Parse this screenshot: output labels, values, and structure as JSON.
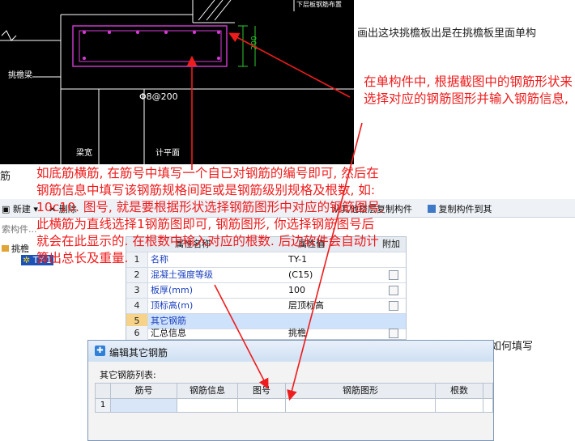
{
  "cad": {
    "label_left_mid": "挑檐梁",
    "label_top_right": "下层板钢筋布置",
    "dim_vertical": "200",
    "rebar_spec": "Φ8@200",
    "label_bottom_left": "梁宽",
    "label_bottom_mid": "计平面"
  },
  "hint_right_top": "画出这块挑檐板出是在挑檐板里面单构",
  "hint_left": "筋",
  "hint_right_mid": "如何填写",
  "annotations": {
    "right_note": "在单构件中, 根据截图中的钢筋形状来选择对应的钢筋图形并输入钢筋信息,",
    "left_note": "如底筋横筋, 在筋号中填写一个自已对钢筋的编号即可, 然后在钢筋信息中填写该钢筋规格间距或是钢筋级别规格及根数, 如: 10c10. 图号, 就是要根据形状选择钢筋图形中对应的钢筋图号, 此横筋为直线选择1钢筋图即可, 钢筋图形, 你选择钢筋图号后就会在此显示的. 在根数中输入对应的根数. 后边软件会自动计算出总长及重量."
  },
  "toolbar": {
    "new_label": "新建",
    "delete_label": "删除",
    "other_floor_copy": "从其他楼层复制构件",
    "copy_to_other": "复制构件到其"
  },
  "search": {
    "placeholder": "索构件..."
  },
  "tree": {
    "root": "挑檐",
    "child": "TY-1"
  },
  "propgrid": {
    "headers": {
      "name": "属性名称",
      "value": "属性值",
      "extra": "附加"
    },
    "rows": [
      {
        "num": "1",
        "name": "名称",
        "value": "TY-1",
        "check": false
      },
      {
        "num": "2",
        "name": "混凝土强度等级",
        "value": "(C15)",
        "check": true
      },
      {
        "num": "3",
        "name": "板厚(mm)",
        "value": "100",
        "check": true
      },
      {
        "num": "4",
        "name": "顶标高(m)",
        "value": "层顶标高",
        "check": true
      },
      {
        "num": "5",
        "name": "其它钢筋",
        "value": "",
        "check": false
      },
      {
        "num": "6",
        "name": "汇总信息",
        "value": "挑檐",
        "check": true
      }
    ]
  },
  "dialog": {
    "title": "编辑其它钢筋",
    "list_label": "其它钢筋列表:",
    "columns": [
      "筋号",
      "钢筋信息",
      "图号",
      "钢筋图形",
      "根数"
    ],
    "row_num": "1"
  },
  "colors": {
    "annotation": "#ee1c1c",
    "cad_bg": "#000000",
    "cad_magenta": "#d63cd6",
    "cad_green": "#2fc92f"
  }
}
